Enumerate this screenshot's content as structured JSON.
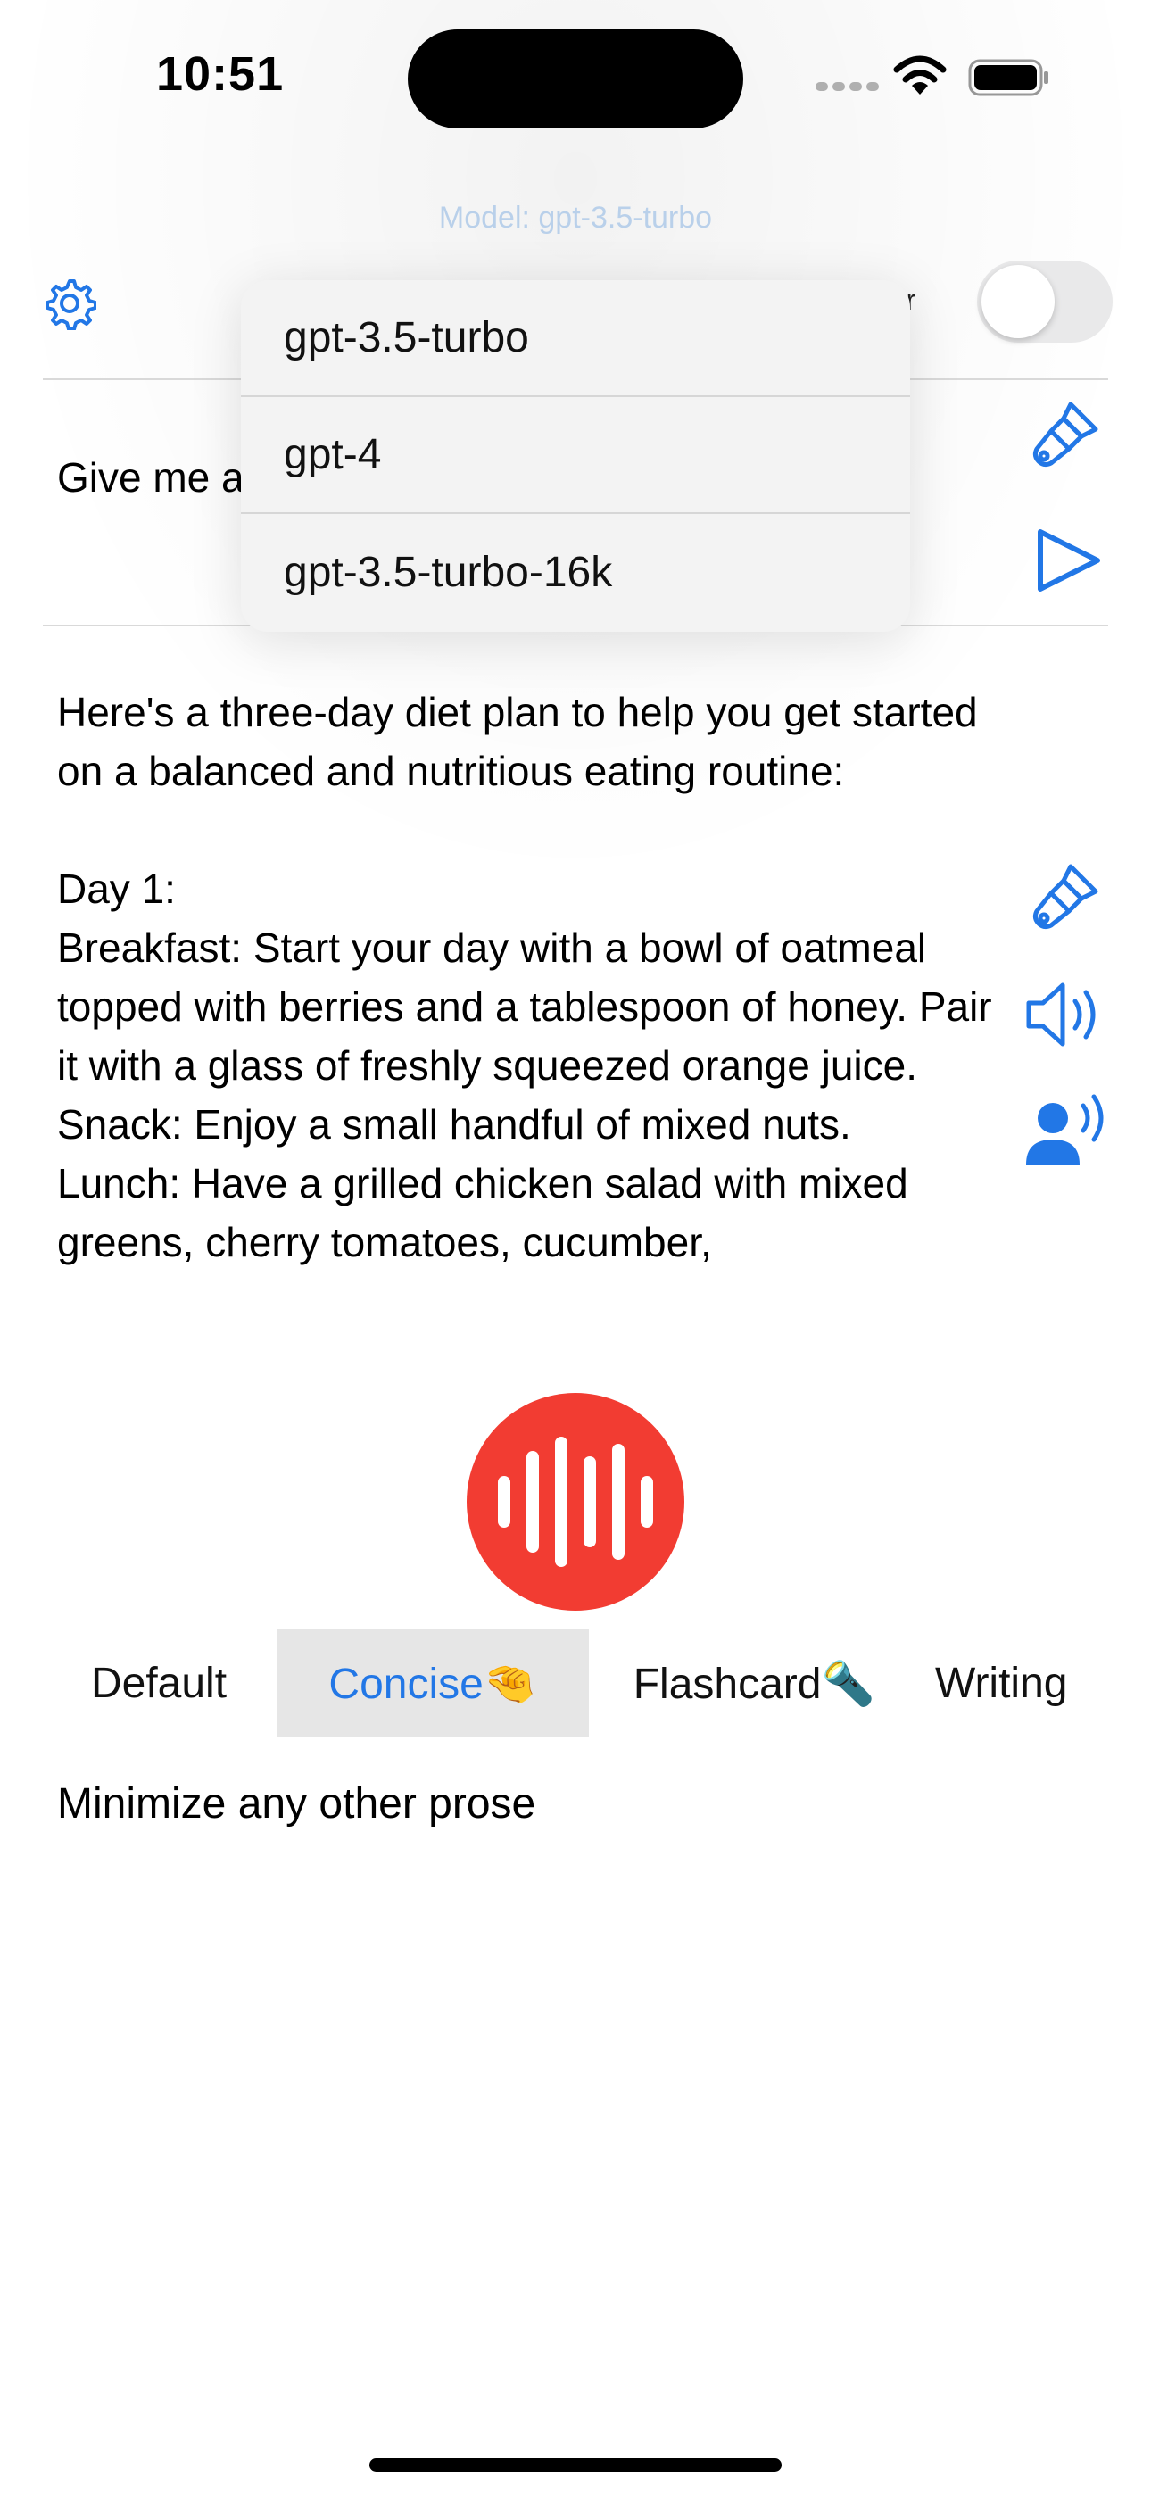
{
  "status_bar": {
    "time": "10:51"
  },
  "header": {
    "model_label": "Model: gpt-3.5-turbo",
    "number_label": "ber",
    "number_toggle_on": false
  },
  "model_menu": {
    "options": [
      "gpt-3.5-turbo",
      "gpt-4",
      "gpt-3.5-turbo-16k"
    ]
  },
  "prompt": {
    "text": "Give me a"
  },
  "response": {
    "text": "Here's a three-day diet plan to help you get started on a balanced and nutritious eating routine:\n\nDay 1:\nBreakfast: Start your day with a bowl of oatmeal topped with berries and a tablespoon of honey. Pair it with a glass of freshly squeezed orange juice.\nSnack: Enjoy a small handful of mixed nuts.\nLunch: Have a grilled chicken salad with mixed greens, cherry tomatoes, cucumber,"
  },
  "mode_tabs": [
    {
      "label": "Default",
      "selected": false
    },
    {
      "label": "Concise🤏",
      "selected": true
    },
    {
      "label": "Flashcard🔦",
      "selected": false
    },
    {
      "label": "Writing",
      "selected": false
    }
  ],
  "mode_description": "Minimize any other prose",
  "colors": {
    "accent": "#2277e6",
    "record": "#f23c32",
    "model_label": "#b9d0ea"
  },
  "icons": {
    "settings": "gear-icon",
    "clear_prompt": "paintbrush-icon",
    "send": "play-icon",
    "clear_response": "paintbrush-icon",
    "speak": "speaker-wave-icon",
    "voice": "person-wave-icon",
    "record": "waveform-icon"
  }
}
